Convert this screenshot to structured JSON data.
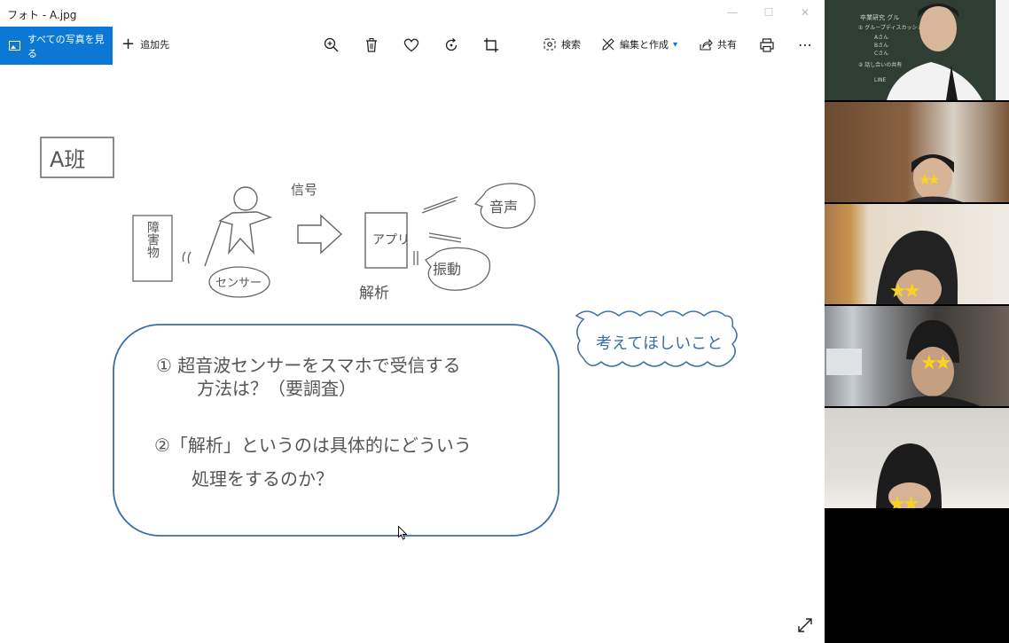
{
  "window": {
    "title": "フォト - A.jpg",
    "controls": {
      "minimize": "—",
      "maximize": "☐",
      "close": "✕"
    }
  },
  "toolbar": {
    "see_all_label": "すべての写真を見る",
    "add_to_label": "追加先",
    "search_label": "検索",
    "edit_create_label": "編集と作成",
    "share_label": "共有",
    "more_label": "⋯",
    "icons": [
      "zoom-in-icon",
      "trash-icon",
      "heart-icon",
      "rotate-icon",
      "crop-icon",
      "search-icon",
      "edit-icon",
      "share-icon",
      "print-icon",
      "more-icon"
    ],
    "accent_color": "#0a78d4"
  },
  "image": {
    "title_box": "A班",
    "obstacle": "障害物",
    "signal": "信号",
    "sensor": "センサー",
    "app": "アプリ",
    "voice": "音声",
    "vibration": "振動",
    "analysis": "解析",
    "think_about": "考えてほしいこと",
    "question1_line1": "① 超音波センサーをスマホで受信する",
    "question1_line2": "方法は？（要調査）",
    "question2_line1": "②「解析」というのは具体的にどういう",
    "question2_line2": "処理をするのか？"
  },
  "video_panel": {
    "tiles": [
      {
        "name": "teacher",
        "board_lines": [
          "卒業研究 グル",
          "① グループディスカッション",
          "Aさん",
          "Bさん",
          "Cさん",
          "② 話し合いの共有",
          "LINE"
        ]
      },
      {
        "name": "participant-1",
        "stars": "★★"
      },
      {
        "name": "participant-2",
        "stars": "★★"
      },
      {
        "name": "participant-3",
        "stars": "★★"
      },
      {
        "name": "participant-4",
        "stars": "★★"
      }
    ],
    "star_color": "#f8d41f"
  }
}
